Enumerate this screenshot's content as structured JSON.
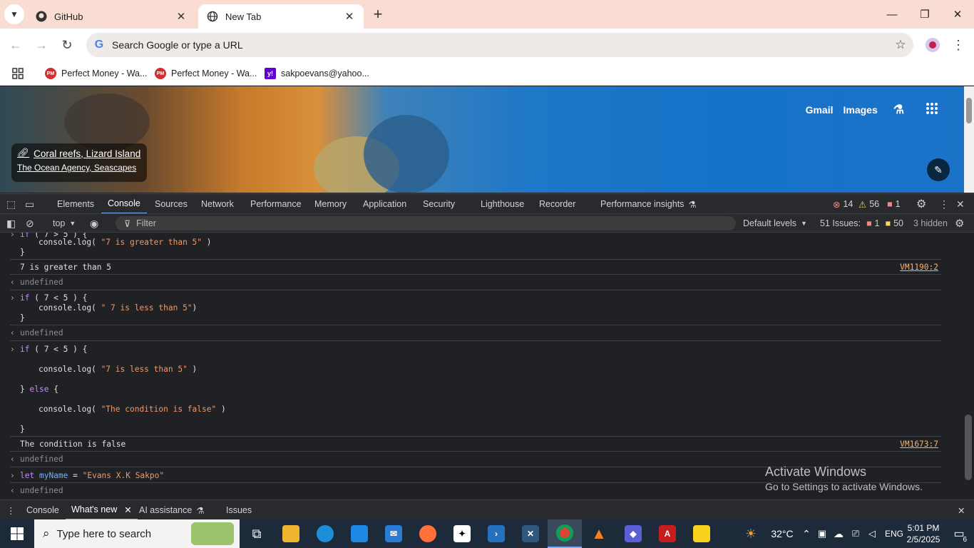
{
  "browser": {
    "tabs": [
      {
        "title": "GitHub"
      },
      {
        "title": "New Tab"
      }
    ],
    "omnibox_placeholder": "Search Google or type a URL",
    "bookmarks": [
      {
        "label": "Perfect Money - Wa...",
        "icon_text": "PM"
      },
      {
        "label": "Perfect Money - Wa...",
        "icon_text": "PM"
      },
      {
        "label": "sakpoevans@yahoo...",
        "icon_text": "y!"
      }
    ]
  },
  "newtab": {
    "attribution_title": "Coral reefs, Lizard Island",
    "attribution_sub": "The Ocean Agency, Seascapes",
    "header_links": [
      "Gmail",
      "Images"
    ]
  },
  "devtools": {
    "tabs": [
      "Elements",
      "Console",
      "Sources",
      "Network",
      "Performance",
      "Memory",
      "Application",
      "Security",
      "Lighthouse",
      "Recorder",
      "Performance insights"
    ],
    "active_tab": "Console",
    "counts": {
      "errors": "14",
      "warnings": "56",
      "issues": "1"
    },
    "context": "top",
    "filter_placeholder": "Filter",
    "levels": "Default levels",
    "issues_label": "51 Issues:",
    "issues_err": "1",
    "issues_warn": "50",
    "hidden": "3 hidden",
    "drawer_tabs": [
      "Console",
      "What's new",
      "AI assistance",
      "Issues"
    ]
  },
  "console": {
    "l1_code": "console.log( ",
    "l1_str": "\"7 is greater than 5\"",
    "l1_close": " )",
    "brace": "}",
    "out1": "7 is greater than 5",
    "src1": "VM1190:2",
    "undef": "undefined",
    "l2_if": "if",
    "l2_cond": " ( 7 < 5 ) {",
    "l2_log": "console.log( ",
    "l2_str": "\" 7 is less than 5\"",
    "l2_close": ")",
    "l3_log": "console.log( ",
    "l3_str": "\"7 is less than 5\"",
    "l3_close": " )",
    "l3_else": "else",
    "l3_else_brace": " {",
    "l3_str2": "\"The condition is false\"",
    "out2": "The condition is false",
    "src2": "VM1673:7",
    "l4_let": "let",
    "l4_var": "myName",
    "l4_eq": " = ",
    "l4_str": "\"Evans X.K Sakpo\""
  },
  "watermark": {
    "line1": "Activate Windows",
    "line2": "Go to Settings to activate Windows."
  },
  "taskbar": {
    "search_placeholder": "Type here to search",
    "temperature": "32°C",
    "language": "ENG",
    "time": "5:01 PM",
    "date": "2/5/2025",
    "notifications": "6"
  }
}
